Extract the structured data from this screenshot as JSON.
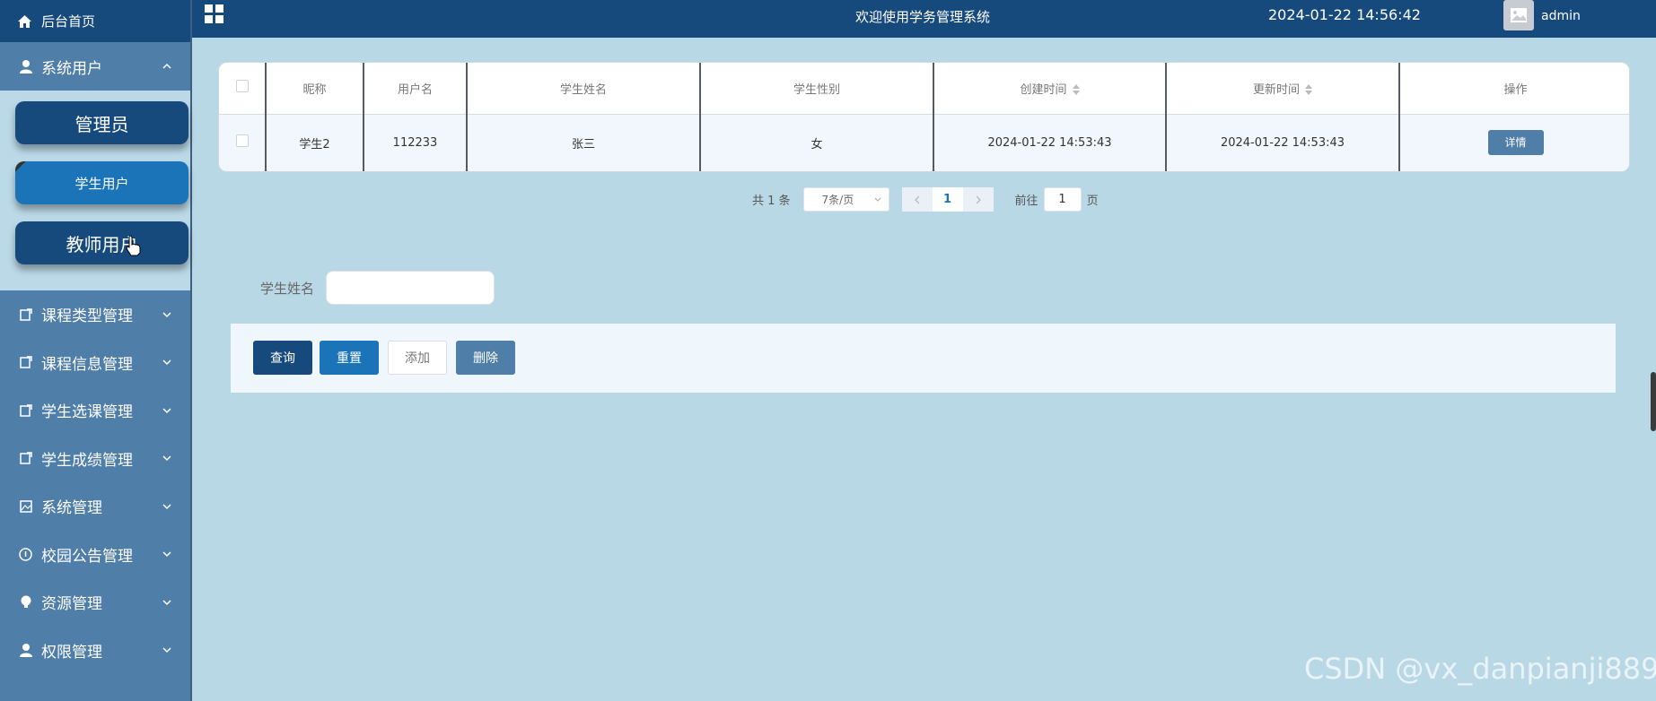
{
  "sidebar": {
    "home": "后台首页",
    "system_users": "系统用户",
    "sub_items": [
      "管理员",
      "学生用户",
      "教师用户"
    ],
    "menus": [
      "课程类型管理",
      "课程信息管理",
      "学生选课管理",
      "学生成绩管理",
      "系统管理",
      "校园公告管理",
      "资源管理",
      "权限管理"
    ]
  },
  "header": {
    "title": "欢迎使用学务管理系统",
    "time": "2024-01-22 14:56:42",
    "user": "admin"
  },
  "table": {
    "columns": [
      "昵称",
      "用户名",
      "学生姓名",
      "学生性别",
      "创建时间",
      "更新时间",
      "操作"
    ],
    "rows": [
      {
        "nickname": "学生2",
        "username": "112233",
        "name": "张三",
        "gender": "女",
        "created": "2024-01-22 14:53:43",
        "updated": "2024-01-22 14:53:43",
        "action": "详情"
      }
    ]
  },
  "pager": {
    "total": "共 1 条",
    "size": "7条/页",
    "page": "1",
    "goto_label": "前往",
    "goto_value": "1",
    "page_suffix": "页"
  },
  "search": {
    "label": "学生姓名",
    "value": ""
  },
  "actions": {
    "query": "查询",
    "reset": "重置",
    "add": "添加",
    "delete": "删除"
  },
  "watermark": "CSDN @vx_danpianji889"
}
